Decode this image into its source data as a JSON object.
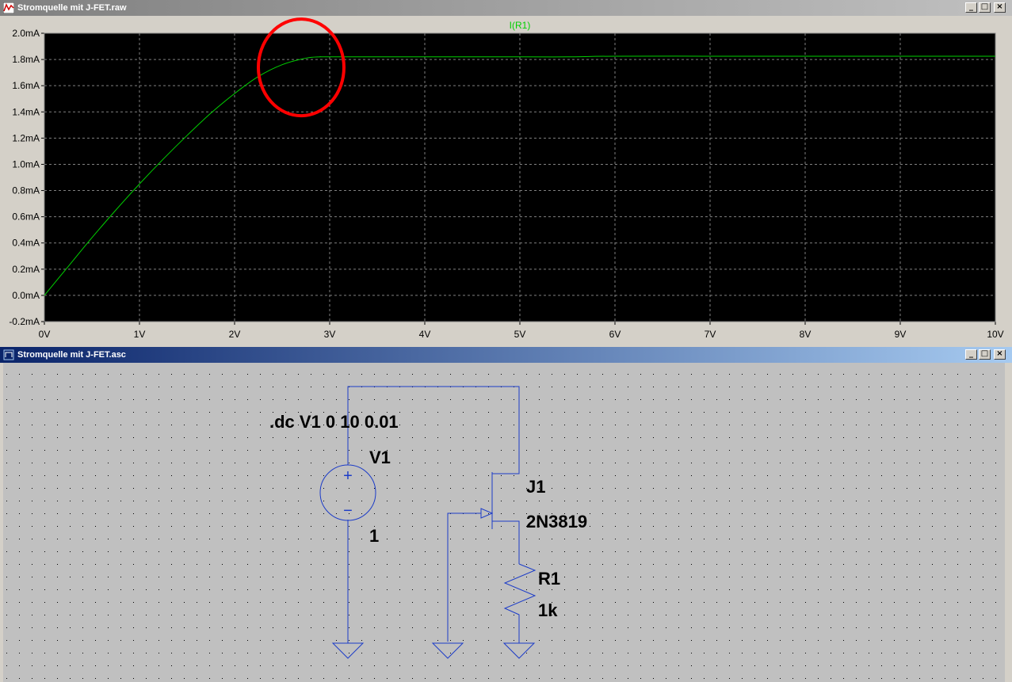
{
  "plot_window": {
    "title": "Stromquelle mit J-FET.raw",
    "minimize": "_",
    "maximize": "□",
    "close": "×"
  },
  "schematic_window": {
    "title": "Stromquelle mit J-FET.asc",
    "minimize": "_",
    "maximize": "□",
    "close": "×"
  },
  "colors": {
    "plot_background": "#000000",
    "trace": "#00d000",
    "axis_text": "#000000",
    "wire": "#1c3cc8",
    "annotation_circle": "#ff0000",
    "schematic_background": "#c0c0c0"
  },
  "chart_data": {
    "type": "line",
    "title": "",
    "xlabel": "",
    "ylabel": "",
    "xlim": [
      0,
      10
    ],
    "ylim": [
      -0.2,
      2.0
    ],
    "grid": true,
    "x_ticks": [
      "0V",
      "1V",
      "2V",
      "3V",
      "4V",
      "5V",
      "6V",
      "7V",
      "8V",
      "9V",
      "10V"
    ],
    "y_ticks": [
      "-0.2mA",
      "0.0mA",
      "0.2mA",
      "0.4mA",
      "0.6mA",
      "0.8mA",
      "1.0mA",
      "1.2mA",
      "1.4mA",
      "1.6mA",
      "1.8mA",
      "2.0mA"
    ],
    "legend_position": "top-center",
    "series": [
      {
        "name": "I(R1)",
        "x": [
          0,
          0.25,
          0.5,
          0.75,
          1.0,
          1.25,
          1.5,
          1.75,
          2.0,
          2.25,
          2.5,
          2.75,
          2.9,
          3.0,
          4.0,
          5.0,
          5.5,
          6.0,
          7.0,
          8.0,
          9.0,
          10.0
        ],
        "y": [
          0.0,
          0.22,
          0.44,
          0.65,
          0.85,
          1.04,
          1.22,
          1.39,
          1.54,
          1.67,
          1.76,
          1.81,
          1.82,
          1.82,
          1.82,
          1.82,
          1.82,
          1.825,
          1.825,
          1.825,
          1.825,
          1.825
        ]
      }
    ],
    "annotation": {
      "shape": "ellipse",
      "x": 2.7,
      "y": 1.8,
      "color": "#ff0000"
    }
  },
  "schematic": {
    "directive": ".dc V1 0 10 0.01",
    "v1_name": "V1",
    "v1_value": "1",
    "v1_plus": "+",
    "v1_minus": "−",
    "j1_name": "J1",
    "j1_model": "2N3819",
    "r1_name": "R1",
    "r1_value": "1k"
  }
}
